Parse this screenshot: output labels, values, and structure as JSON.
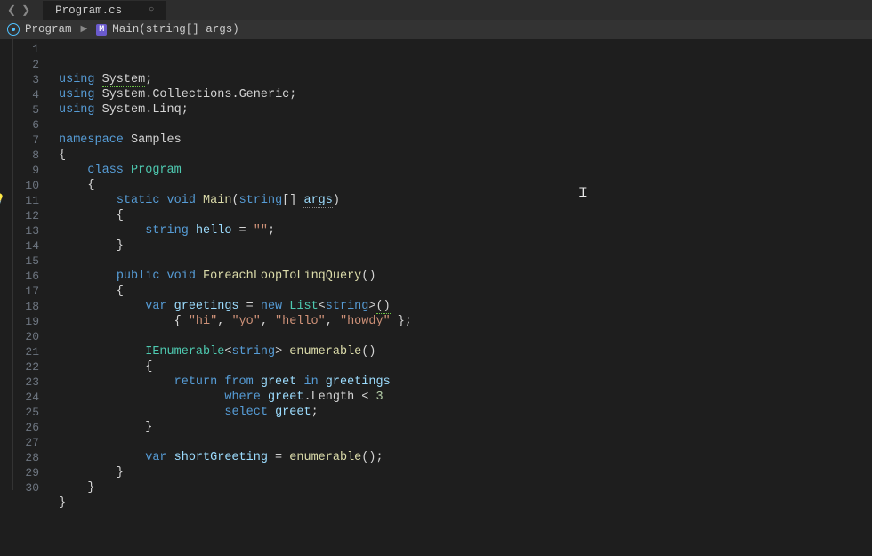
{
  "tab": {
    "filename": "Program.cs"
  },
  "breadcrumb": {
    "class": "Program",
    "method": "Main(string[] args)"
  },
  "gutter": {
    "lines": [
      "1",
      "2",
      "3",
      "4",
      "5",
      "6",
      "7",
      "8",
      "9",
      "10",
      "11",
      "12",
      "13",
      "14",
      "15",
      "16",
      "17",
      "18",
      "19",
      "20",
      "21",
      "22",
      "23",
      "24",
      "25",
      "26",
      "27",
      "28",
      "29",
      "30"
    ]
  },
  "code": {
    "tokens": [
      [
        [
          "kw",
          "using "
        ],
        [
          "plain under-green",
          "System"
        ],
        [
          "punct",
          ";"
        ]
      ],
      [
        [
          "kw",
          "using "
        ],
        [
          "plain",
          "System"
        ],
        [
          "punct",
          "."
        ],
        [
          "plain",
          "Collections"
        ],
        [
          "punct",
          "."
        ],
        [
          "plain",
          "Generic"
        ],
        [
          "punct",
          ";"
        ]
      ],
      [
        [
          "kw",
          "using "
        ],
        [
          "plain",
          "System"
        ],
        [
          "punct",
          "."
        ],
        [
          "plain",
          "Linq"
        ],
        [
          "punct",
          ";"
        ]
      ],
      [],
      [
        [
          "kw",
          "namespace "
        ],
        [
          "plain",
          "Samples"
        ]
      ],
      [
        [
          "punct",
          "{"
        ]
      ],
      [
        [
          "punct",
          "    "
        ],
        [
          "kw",
          "class "
        ],
        [
          "type",
          "Program"
        ]
      ],
      [
        [
          "punct",
          "    {"
        ]
      ],
      [
        [
          "punct",
          "        "
        ],
        [
          "kw",
          "static "
        ],
        [
          "kw",
          "void "
        ],
        [
          "id",
          "Main"
        ],
        [
          "punct",
          "("
        ],
        [
          "kw",
          "string"
        ],
        [
          "punct",
          "[] "
        ],
        [
          "var under-dim",
          "args"
        ],
        [
          "punct",
          ")"
        ]
      ],
      [
        [
          "punct",
          "        {"
        ]
      ],
      [
        [
          "punct",
          "            "
        ],
        [
          "kw",
          "string "
        ],
        [
          "var under-yellow",
          "hello"
        ],
        [
          "plain",
          " = "
        ],
        [
          "str",
          "\"\""
        ],
        [
          "punct",
          ";"
        ]
      ],
      [
        [
          "punct",
          "        }"
        ]
      ],
      [],
      [
        [
          "punct",
          "        "
        ],
        [
          "kw",
          "public "
        ],
        [
          "kw",
          "void "
        ],
        [
          "id",
          "ForeachLoopToLinqQuery"
        ],
        [
          "punct",
          "()"
        ]
      ],
      [
        [
          "punct",
          "        {"
        ]
      ],
      [
        [
          "punct",
          "            "
        ],
        [
          "kw",
          "var "
        ],
        [
          "var",
          "greetings"
        ],
        [
          "plain",
          " = "
        ],
        [
          "kw",
          "new "
        ],
        [
          "type",
          "List"
        ],
        [
          "punct",
          "<"
        ],
        [
          "kw",
          "string"
        ],
        [
          "punct",
          ">"
        ],
        [
          "punct under-green",
          "()"
        ]
      ],
      [
        [
          "punct",
          "                { "
        ],
        [
          "str",
          "\"hi\""
        ],
        [
          "punct",
          ", "
        ],
        [
          "str",
          "\"yo\""
        ],
        [
          "punct",
          ", "
        ],
        [
          "str",
          "\"hello\""
        ],
        [
          "punct",
          ", "
        ],
        [
          "str",
          "\"howdy\""
        ],
        [
          "punct",
          " };"
        ]
      ],
      [],
      [
        [
          "punct",
          "            "
        ],
        [
          "type",
          "IEnumerable"
        ],
        [
          "punct",
          "<"
        ],
        [
          "kw",
          "string"
        ],
        [
          "punct",
          "> "
        ],
        [
          "id",
          "enumerable"
        ],
        [
          "punct",
          "()"
        ]
      ],
      [
        [
          "punct",
          "            {"
        ]
      ],
      [
        [
          "punct",
          "                "
        ],
        [
          "kw",
          "return "
        ],
        [
          "kw",
          "from "
        ],
        [
          "var",
          "greet"
        ],
        [
          "plain",
          " "
        ],
        [
          "kw",
          "in "
        ],
        [
          "var",
          "greetings"
        ]
      ],
      [
        [
          "punct",
          "                       "
        ],
        [
          "kw",
          "where "
        ],
        [
          "var",
          "greet"
        ],
        [
          "punct",
          "."
        ],
        [
          "plain",
          "Length"
        ],
        [
          "plain",
          " < "
        ],
        [
          "num",
          "3"
        ]
      ],
      [
        [
          "punct",
          "                       "
        ],
        [
          "kw",
          "select "
        ],
        [
          "var",
          "greet"
        ],
        [
          "punct",
          ";"
        ]
      ],
      [
        [
          "punct",
          "            }"
        ]
      ],
      [],
      [
        [
          "punct",
          "            "
        ],
        [
          "kw",
          "var "
        ],
        [
          "var",
          "shortGreeting"
        ],
        [
          "plain",
          " = "
        ],
        [
          "id",
          "enumerable"
        ],
        [
          "punct",
          "();"
        ]
      ],
      [
        [
          "punct",
          "        }"
        ]
      ],
      [
        [
          "punct",
          "    }"
        ]
      ],
      [
        [
          "punct",
          "}"
        ]
      ],
      []
    ]
  }
}
